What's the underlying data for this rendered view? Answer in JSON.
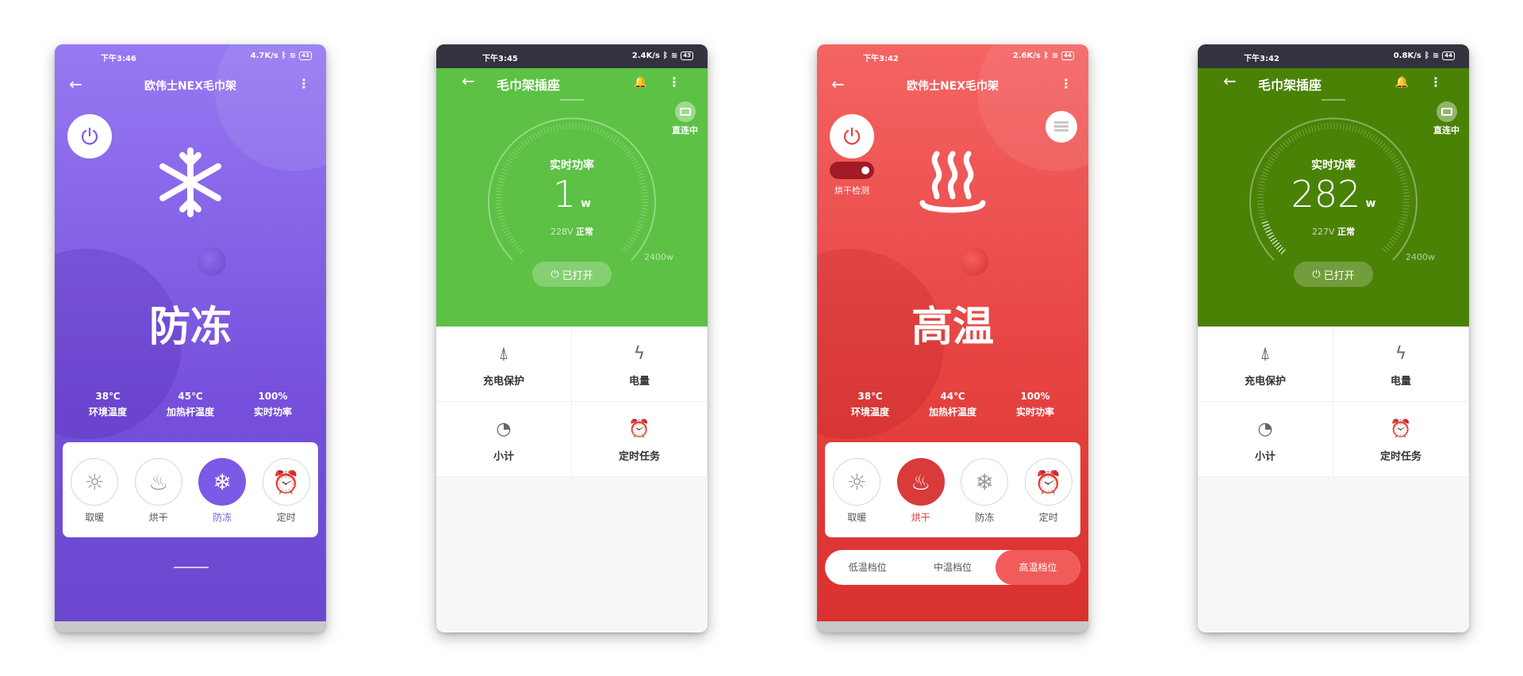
{
  "phone1": {
    "status": {
      "time": "下午3:46",
      "speed": "4.7K/s",
      "battery": "43"
    },
    "title": "欧伟士NEX毛巾架",
    "mode_big": "防冻",
    "stats": [
      {
        "value": "38℃",
        "label": "环境温度"
      },
      {
        "value": "45℃",
        "label": "加热杆温度"
      },
      {
        "value": "100%",
        "label": "实时功率"
      }
    ],
    "modes": [
      {
        "icon": "sun-icon",
        "label": "取暖"
      },
      {
        "icon": "steam-icon",
        "label": "烘干"
      },
      {
        "icon": "snowflake-icon",
        "label": "防冻"
      },
      {
        "icon": "alarm-icon",
        "label": "定时"
      }
    ],
    "active_mode": "防冻",
    "accent": "#7b5ae6"
  },
  "phone2": {
    "status": {
      "time": "下午3:45",
      "speed": "2.4K/s",
      "battery": "43"
    },
    "title": "毛巾架插座",
    "direct_label": "直连中",
    "dial_title": "实时功率",
    "power_value": "1",
    "power_unit": "w",
    "voltage": "228V",
    "voltage_status": "正常",
    "dial_max": "2400w",
    "open_label": "已打开",
    "grid": [
      {
        "icon": "lightning-rod-icon",
        "label": "充电保护"
      },
      {
        "icon": "bolt-icon",
        "label": "电量"
      },
      {
        "icon": "timer-icon",
        "label": "小计"
      },
      {
        "icon": "alarm-icon",
        "label": "定时任务"
      }
    ],
    "accent": "#5cc144"
  },
  "phone3": {
    "status": {
      "time": "下午3:42",
      "speed": "2.6K/s",
      "battery": "44"
    },
    "title": "欧伟士NEX毛巾架",
    "toggle_label": "烘干检测",
    "mode_big": "高温",
    "stats": [
      {
        "value": "38℃",
        "label": "环境温度"
      },
      {
        "value": "44℃",
        "label": "加热杆温度"
      },
      {
        "value": "100%",
        "label": "实时功率"
      }
    ],
    "modes": [
      {
        "icon": "sun-icon",
        "label": "取暖"
      },
      {
        "icon": "steam-icon",
        "label": "烘干"
      },
      {
        "icon": "snowflake-icon",
        "label": "防冻"
      },
      {
        "icon": "alarm-icon",
        "label": "定时"
      }
    ],
    "active_mode": "烘干",
    "temp_levels": [
      "低温档位",
      "中温档位",
      "高温档位"
    ],
    "active_temp": "高温档位",
    "accent": "#e9403f"
  },
  "phone4": {
    "status": {
      "time": "下午3:42",
      "speed": "0.8K/s",
      "battery": "44"
    },
    "title": "毛巾架插座",
    "direct_label": "直连中",
    "dial_title": "实时功率",
    "power_value": "282",
    "power_unit": "w",
    "voltage": "227V",
    "voltage_status": "正常",
    "dial_max": "2400w",
    "open_label": "已打开",
    "grid": [
      {
        "icon": "lightning-rod-icon",
        "label": "充电保护"
      },
      {
        "icon": "bolt-icon",
        "label": "电量"
      },
      {
        "icon": "timer-icon",
        "label": "小计"
      },
      {
        "icon": "alarm-icon",
        "label": "定时任务"
      }
    ],
    "accent": "#4a8206"
  }
}
